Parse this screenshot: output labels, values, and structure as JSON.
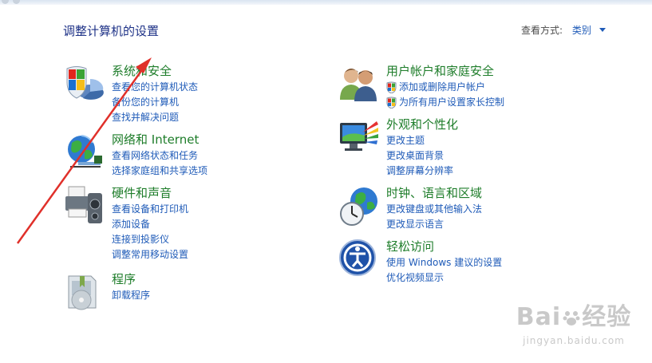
{
  "header": {
    "title": "调整计算机的设置",
    "view_by_label": "查看方式:",
    "view_by_value": "类别"
  },
  "categories": [
    {
      "title": "系统和安全",
      "icon": "shield-pie-icon",
      "links": [
        "查看您的计算机状态",
        "备份您的计算机",
        "查找并解决问题"
      ]
    },
    {
      "title": "网络和 Internet",
      "icon": "globe-network-icon",
      "links": [
        "查看网络状态和任务",
        "选择家庭组和共享选项"
      ]
    },
    {
      "title": "硬件和声音",
      "icon": "printer-speaker-icon",
      "links": [
        "查看设备和打印机",
        "添加设备",
        "连接到投影仪",
        "调整常用移动设置"
      ]
    },
    {
      "title": "程序",
      "icon": "program-box-icon",
      "links": [
        "卸载程序"
      ]
    },
    {
      "title": "用户帐户和家庭安全",
      "icon": "users-icon",
      "links": [
        "添加或删除用户帐户",
        "为所有用户设置家长控制"
      ]
    },
    {
      "title": "外观和个性化",
      "icon": "monitor-palette-icon",
      "links": [
        "更改主题",
        "更改桌面背景",
        "调整屏幕分辨率"
      ]
    },
    {
      "title": "时钟、语言和区域",
      "icon": "clock-globe-icon",
      "links": [
        "更改键盘或其他输入法",
        "更改显示语言"
      ]
    },
    {
      "title": "轻松访问",
      "icon": "accessibility-icon",
      "links": [
        "使用 Windows 建议的设置",
        "优化视频显示"
      ]
    }
  ],
  "watermark": {
    "brand_left": "Bai",
    "brand_right": "经验",
    "url": "jingyan.baidu.com"
  },
  "colors": {
    "title_blue": "#1e3287",
    "category_green": "#1e7d2a",
    "link_blue": "#1f5bb8",
    "annotation_red": "#e0302a"
  }
}
